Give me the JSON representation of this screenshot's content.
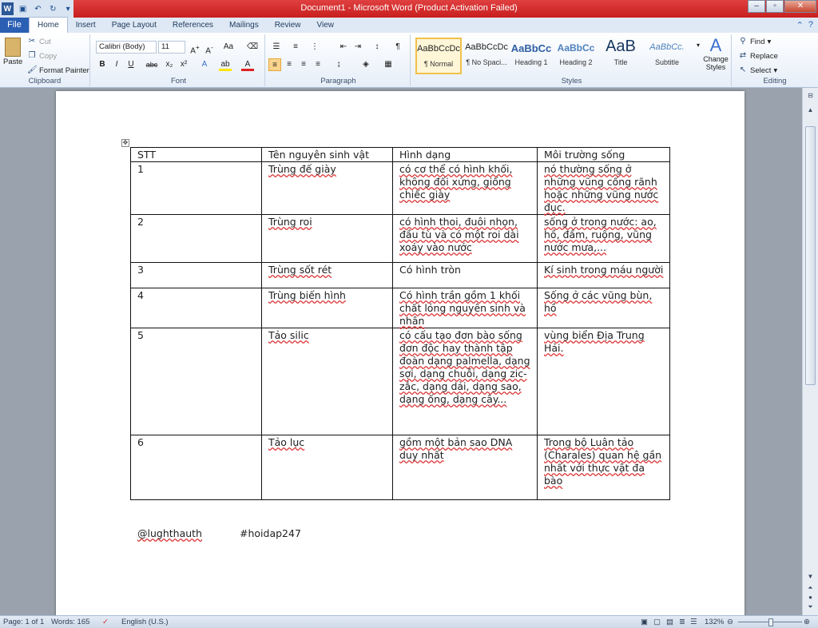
{
  "window": {
    "title": "Document1 - Microsoft Word (Product Activation Failed)",
    "app_icon": "W"
  },
  "tabs": [
    "File",
    "Home",
    "Insert",
    "Page Layout",
    "References",
    "Mailings",
    "Review",
    "View"
  ],
  "active_tab": "Home",
  "ribbon": {
    "clipboard": {
      "paste": "Paste",
      "cut": "Cut",
      "copy": "Copy",
      "format_painter": "Format Painter",
      "label": "Clipboard"
    },
    "font": {
      "font_name": "Calibri (Body)",
      "font_size": "11",
      "label": "Font"
    },
    "paragraph": {
      "label": "Paragraph"
    },
    "styles": {
      "items": [
        {
          "sample": "AaBbCcDc",
          "name": "¶ Normal"
        },
        {
          "sample": "AaBbCcDc",
          "name": "¶ No Spaci..."
        },
        {
          "sample": "AaBbCc",
          "name": "Heading 1"
        },
        {
          "sample": "AaBbCc",
          "name": "Heading 2"
        },
        {
          "sample": "AaB",
          "name": "Title"
        },
        {
          "sample": "AaBbCc.",
          "name": "Subtitle"
        }
      ],
      "change_styles": "Change Styles",
      "label": "Styles"
    },
    "editing": {
      "find": "Find",
      "replace": "Replace",
      "select": "Select",
      "label": "Editing"
    }
  },
  "document": {
    "table": {
      "headers": [
        "STT",
        "Tên nguyên sinh vật",
        "Hình dạng",
        "Môi trường sống"
      ],
      "rows": [
        [
          "1",
          "Trùng đế giày",
          "có cơ thể có hình khối, không đối xứng, giống chiếc giày",
          "nó thường sống ở  những vũng cống rãnh hoặc những vũng nước đục."
        ],
        [
          "2",
          "Trùng roi",
          "có hình thoi, đuôi nhọn, đầu tù và có một roi dài xoáy vào nước",
          "sống ở trong nước: ao, hồ, đầm, ruộng, vũng nước mưa,..."
        ],
        [
          "3",
          "Trùng sốt rét",
          "Có hình tròn",
          "Kí sinh trong máu người"
        ],
        [
          "4",
          "Trùng biến hình",
          "Có hình trần gồm 1 khối chất lỏng nguyên sinh và nhân",
          "Sống ở các vũng bùn, hồ"
        ],
        [
          "5",
          "Tảo silic",
          "có cấu tạo đơn bào sống đơn độc hay thành tập đoàn dạng palmella, dạng sợi, dạng chuỗi, dạng zic- zắc, dạng dải, dạng sao, dạng ống, dạng cây...",
          "vùng biển Địa Trung Hải."
        ],
        [
          "6",
          "Tảo lục",
          "gồm một bản sao DNA duy nhất",
          "Trong bộ Luân tảo (Charales) quan hệ gần nhất với thực vật đa bào"
        ]
      ]
    },
    "footer_left": "@lughthauth",
    "footer_right": "#hoidap247"
  },
  "status": {
    "page": "Page: 1 of 1",
    "words": "Words: 165",
    "language": "English (U.S.)",
    "zoom": "132%"
  }
}
